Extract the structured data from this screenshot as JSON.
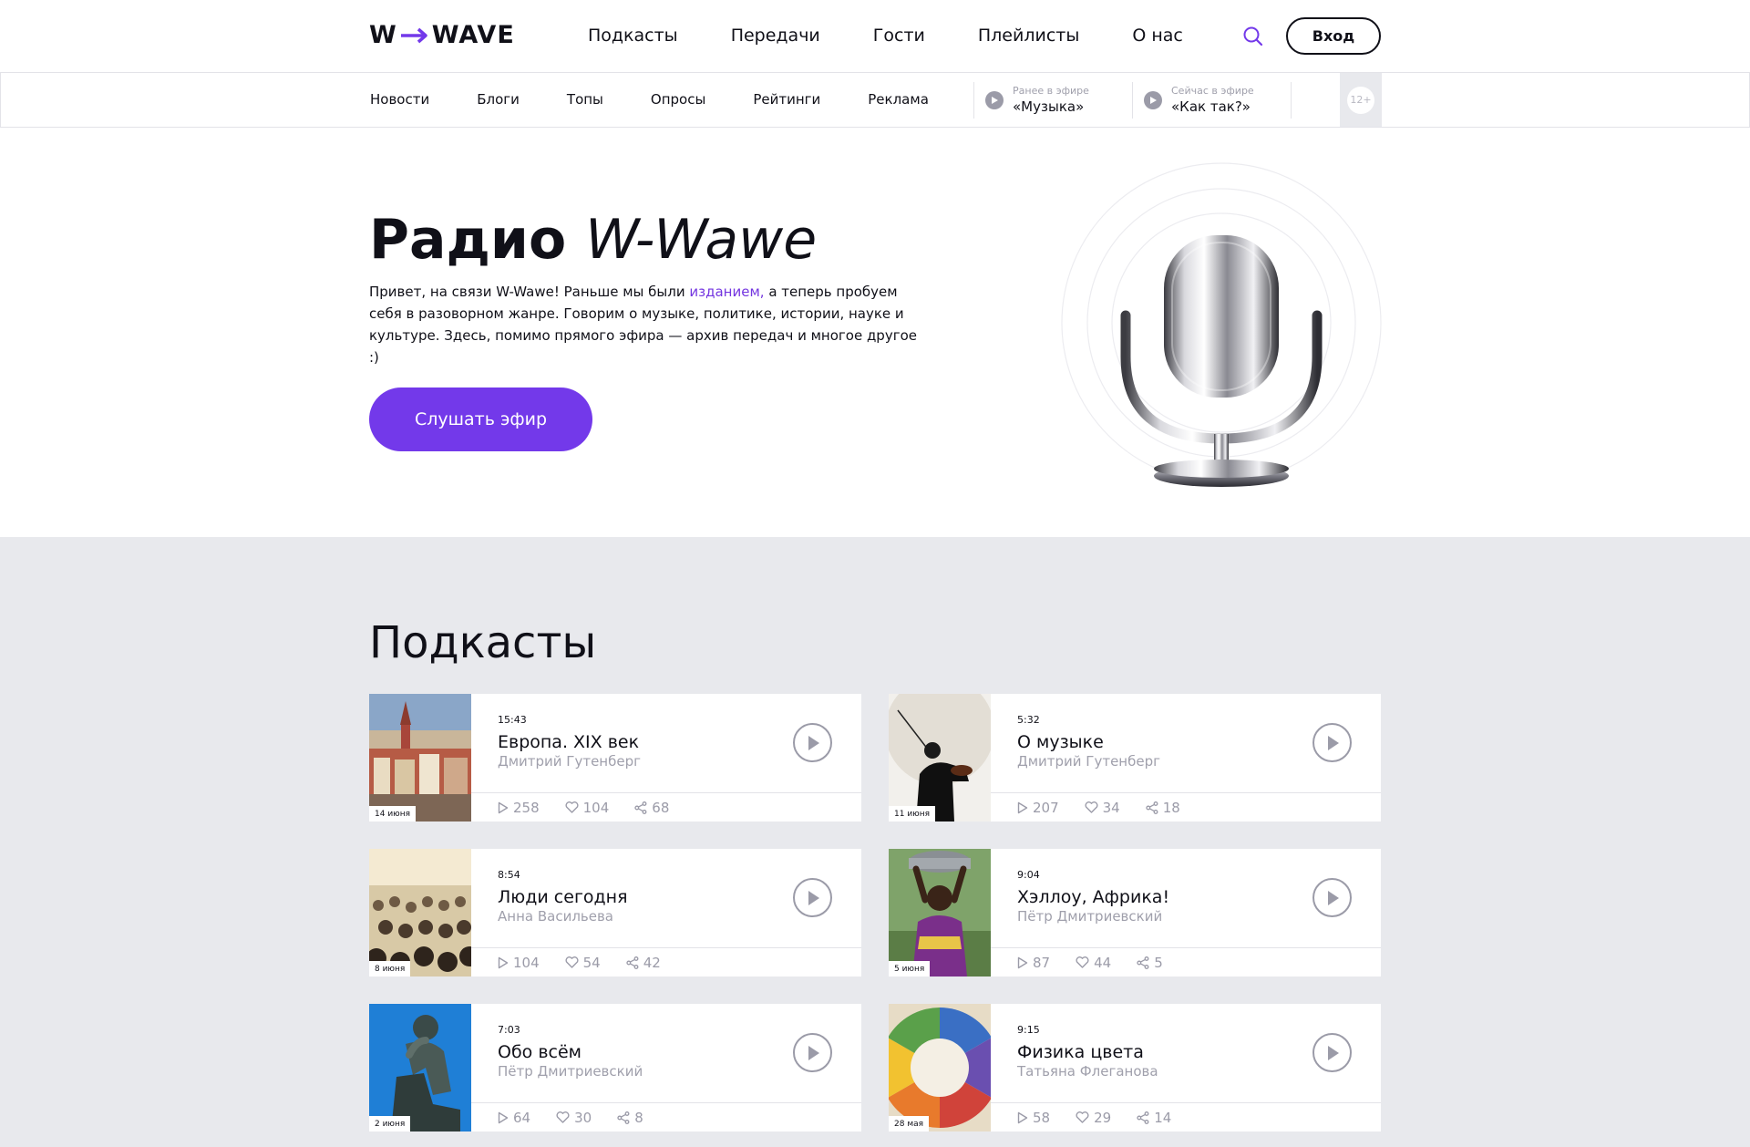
{
  "header": {
    "logo_left": "W",
    "logo_right": "WAVE",
    "nav": [
      "Подкасты",
      "Передачи",
      "Гости",
      "Плейлисты",
      "О нас"
    ],
    "login_label": "Вход"
  },
  "subnav": {
    "links": [
      "Новости",
      "Блоги",
      "Топы",
      "Опросы",
      "Рейтинги",
      "Реклама"
    ],
    "previous": {
      "label": "Ранее в эфире",
      "title": "«Музыка»"
    },
    "current": {
      "label": "Сейчас в эфире",
      "title": "«Как так?»"
    },
    "age_rating": "12+"
  },
  "hero": {
    "title_bold": "Радио",
    "title_italic": "W-Wawe",
    "desc_before_link": "Привет, на связи W-Wawe! Раньше мы были",
    "desc_link": "изданием,",
    "desc_after_link": "а теперь пробуем себя в разоворном жанре. Говорим о музыке, политике, истории, науке и культуре. Здесь, помимо прямого эфира — архив передач и многое другое :)",
    "cta_label": "Слушать эфир"
  },
  "podcasts": {
    "title": "Подкасты",
    "items": [
      {
        "date": "14 июня",
        "duration": "15:43",
        "title": "Европа. XIX век",
        "author": "Дмитрий Гутенберг",
        "plays": "258",
        "likes": "104",
        "shares": "68",
        "thumb": "town-icon"
      },
      {
        "date": "11 июня",
        "duration": "5:32",
        "title": "О музыке",
        "author": "Дмитрий Гутенберг",
        "plays": "207",
        "likes": "34",
        "shares": "18",
        "thumb": "violinist-icon"
      },
      {
        "date": "8 июня",
        "duration": "8:54",
        "title": "Люди сегодня",
        "author": "Анна Васильева",
        "plays": "104",
        "likes": "54",
        "shares": "42",
        "thumb": "crowd-icon"
      },
      {
        "date": "5 июня",
        "duration": "9:04",
        "title": "Хэллоу, Африка!",
        "author": "Пётр Дмитриевский",
        "plays": "87",
        "likes": "44",
        "shares": "5",
        "thumb": "african-woman-icon"
      },
      {
        "date": "2 июня",
        "duration": "7:03",
        "title": "Обо всём",
        "author": "Пётр Дмитриевский",
        "plays": "64",
        "likes": "30",
        "shares": "8",
        "thumb": "thinker-statue-icon"
      },
      {
        "date": "28 мая",
        "duration": "9:15",
        "title": "Физика цвета",
        "author": "Татьяна Флеганова",
        "plays": "58",
        "likes": "29",
        "shares": "14",
        "thumb": "color-wheel-icon"
      }
    ]
  },
  "colors": {
    "accent": "#7339ea",
    "link": "#7436e0",
    "section_bg": "#e8e9ed",
    "muted": "#a0a0ac"
  }
}
